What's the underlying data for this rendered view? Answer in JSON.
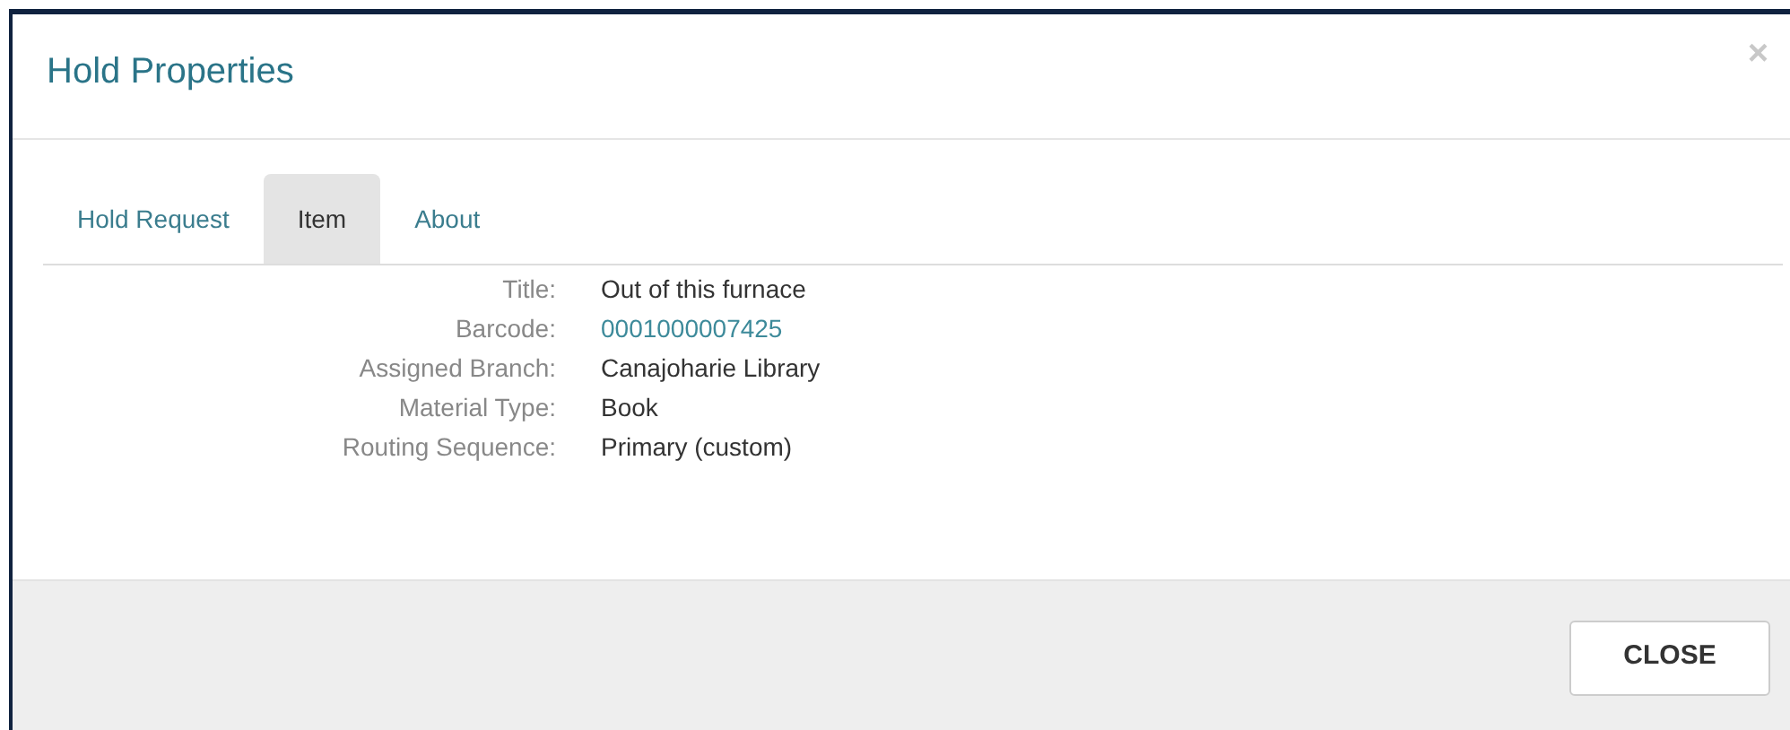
{
  "dialog": {
    "title": "Hold Properties",
    "close_icon": "×"
  },
  "tabs": [
    {
      "label": "Hold Request",
      "selected": false
    },
    {
      "label": "Item",
      "selected": true
    },
    {
      "label": "About",
      "selected": false
    }
  ],
  "fields": [
    {
      "label": "Title:",
      "value": "Out of this furnace",
      "kind": "text"
    },
    {
      "label": "Barcode:",
      "value": "0001000007425",
      "kind": "link"
    },
    {
      "label": "Assigned Branch:",
      "value": "Canajoharie Library",
      "kind": "text"
    },
    {
      "label": "Material Type:",
      "value": "Book",
      "kind": "text"
    },
    {
      "label": "Routing Sequence:",
      "value": "Primary (custom)",
      "kind": "text"
    }
  ],
  "footer": {
    "button": "CLOSE"
  }
}
